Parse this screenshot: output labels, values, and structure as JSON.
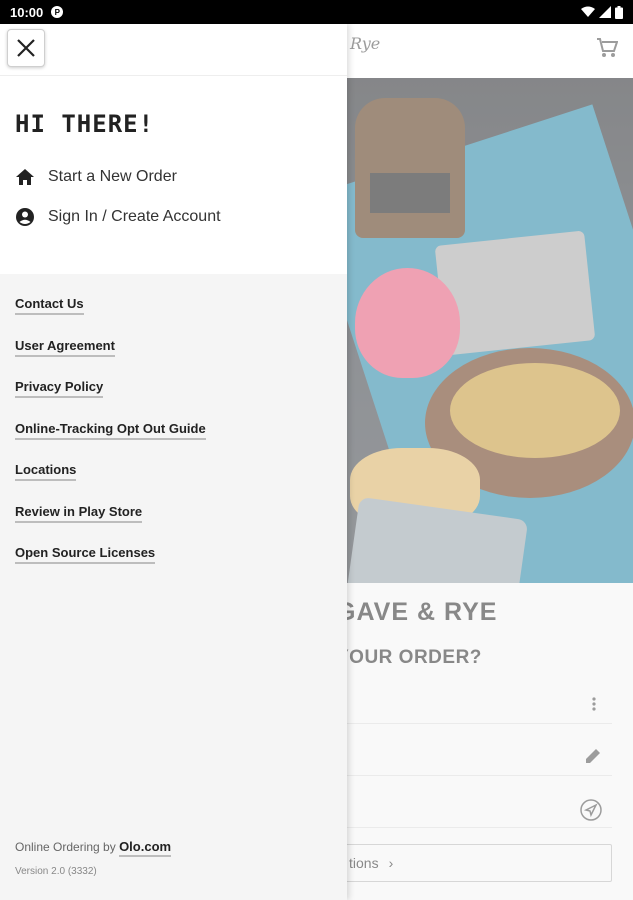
{
  "status_bar": {
    "time": "10:00",
    "app_icon_letter": "P",
    "icons": [
      "wifi-icon",
      "signal-icon",
      "battery-icon"
    ]
  },
  "background": {
    "logo_text": "Rye",
    "restaurant_name": "GAVE & RYE",
    "order_question": "YOUR ORDER?",
    "button_label": "tions",
    "row_icons": [
      "more-vert-icon",
      "edit-pencil-icon",
      "navigation-arrow-icon"
    ]
  },
  "drawer": {
    "greeting": "HI THERE!",
    "menu": {
      "new_order": "Start a New Order",
      "sign_in": "Sign In / Create Account"
    },
    "links": {
      "contact": "Contact Us",
      "user_agreement": "User Agreement",
      "privacy": "Privacy Policy",
      "tracking": "Online-Tracking Opt Out Guide",
      "locations": "Locations",
      "review": "Review in Play Store",
      "licenses": "Open Source Licenses"
    },
    "footer": {
      "powered_by": "Online Ordering by",
      "olo_link": "Olo.com",
      "version": "Version 2.0 (3332)"
    }
  },
  "colors": {
    "status_bar": "#000000",
    "drawer_bg": "#f5f5f5",
    "link_underline": "#bdbdbd",
    "text_dark": "#222222"
  }
}
